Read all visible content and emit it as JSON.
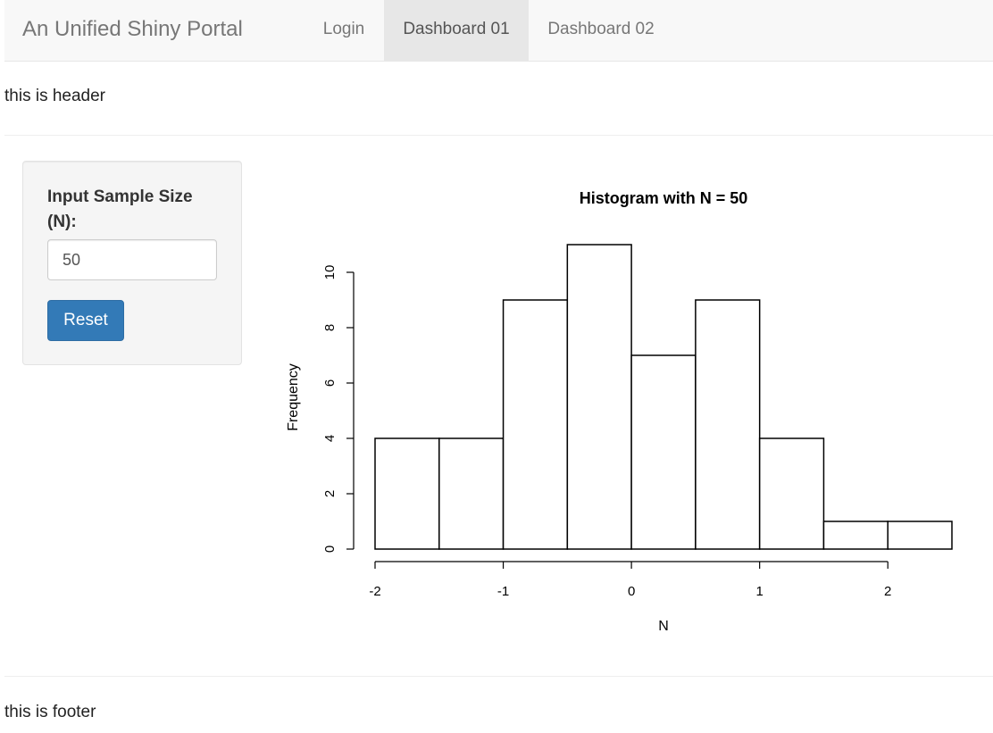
{
  "navbar": {
    "brand": "An Unified Shiny Portal",
    "tabs": [
      {
        "label": "Login",
        "active": false
      },
      {
        "label": "Dashboard 01",
        "active": true
      },
      {
        "label": "Dashboard 02",
        "active": false
      }
    ]
  },
  "header": {
    "text": "this is header"
  },
  "sidebar": {
    "input_label": "Input Sample Size (N):",
    "input_value": "50",
    "reset_label": "Reset"
  },
  "footer": {
    "text": "this is footer"
  },
  "colors": {
    "primary_button": "#337ab7",
    "navbar_bg": "#f8f8f8",
    "active_tab_bg": "#e7e7e7"
  },
  "chart_data": {
    "type": "bar",
    "title": "Histogram with N = 50",
    "xlabel": "N",
    "ylabel": "Frequency",
    "bin_edges": [
      -2,
      -1.5,
      -1,
      -0.5,
      0,
      0.5,
      1,
      1.5,
      2,
      2.5
    ],
    "counts": [
      4,
      4,
      9,
      11,
      7,
      9,
      4,
      1,
      1
    ],
    "xticks": [
      -2,
      -1,
      0,
      1,
      2
    ],
    "yticks": [
      0,
      2,
      4,
      6,
      8,
      10
    ],
    "xlim": [
      -2,
      2.5
    ],
    "ylim": [
      0,
      11
    ],
    "grid": false
  }
}
